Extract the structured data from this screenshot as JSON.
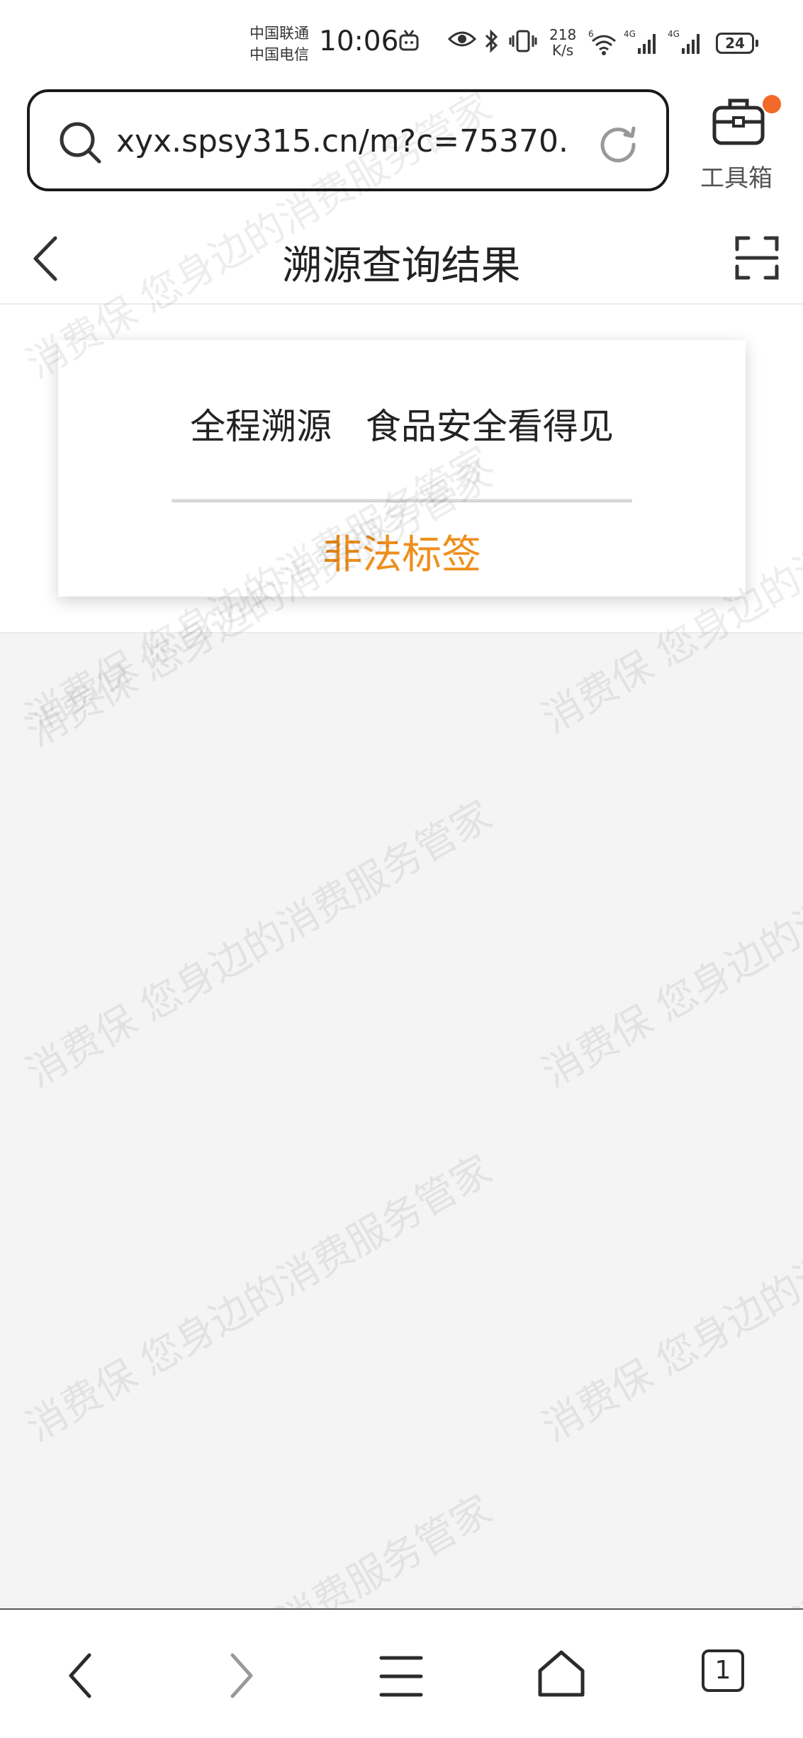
{
  "status_bar": {
    "carrier_1": "中国联通",
    "carrier_2": "中国电信",
    "time": "10:06",
    "net_speed_value": "218",
    "net_speed_unit": "K/s",
    "signal_1_label": "4G",
    "signal_2_label": "4G",
    "wifi_label": "6",
    "battery": "24"
  },
  "url_bar": {
    "url": "xyx.spsy315.cn/m?c=75370..."
  },
  "toolbox": {
    "label": "工具箱"
  },
  "header": {
    "title": "溯源查询结果"
  },
  "card": {
    "slogan": "全程溯源   食品安全看得见",
    "result": "非法标签",
    "result_color": "#ee8f1c"
  },
  "watermark": {
    "text": "消费保 您身边的消费服务管家"
  },
  "bottom_nav": {
    "tabs_count": "1"
  }
}
